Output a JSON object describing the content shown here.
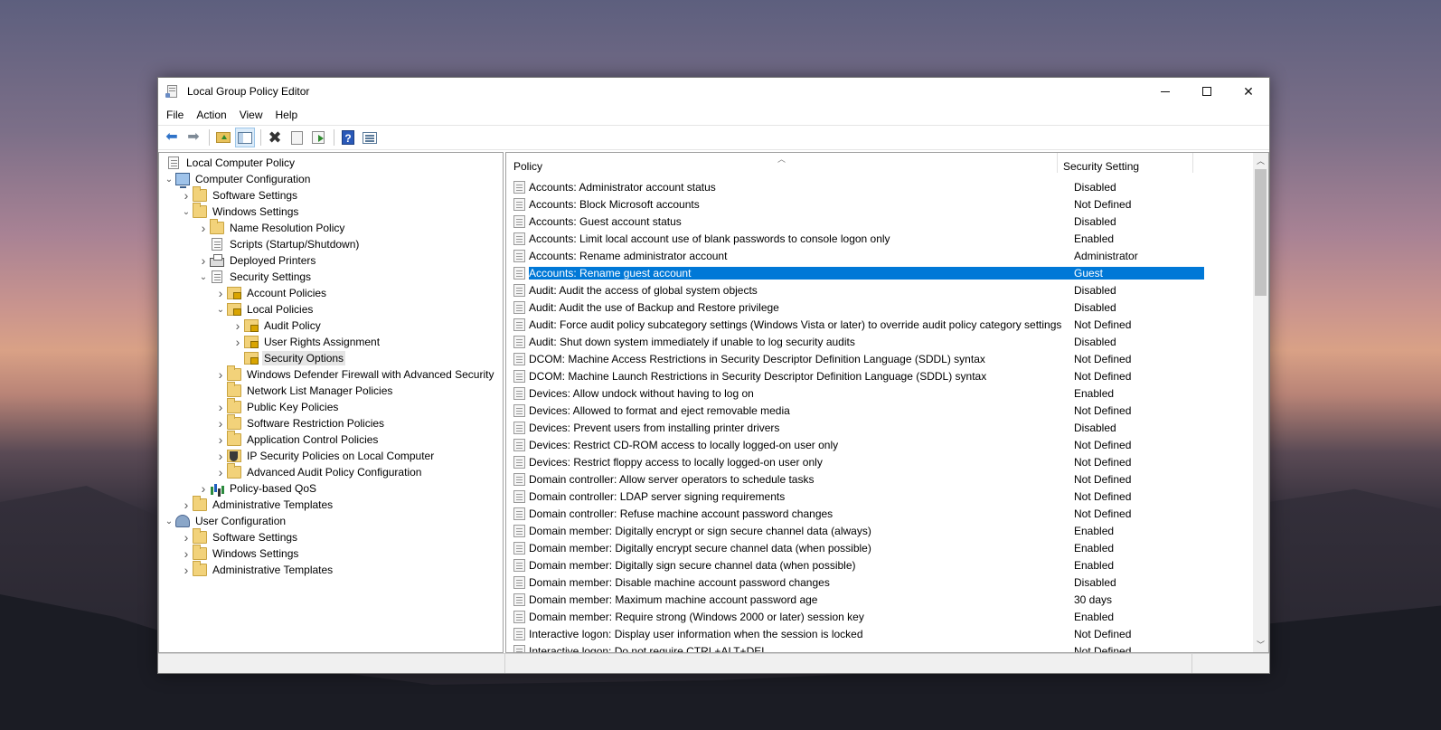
{
  "window": {
    "title": "Local Group Policy Editor"
  },
  "menu": [
    "File",
    "Action",
    "View",
    "Help"
  ],
  "toolbar": [
    {
      "name": "back-button",
      "icon": "back-arrow-icon"
    },
    {
      "name": "forward-button",
      "icon": "forward-arrow-icon"
    },
    {
      "name": "up-one-level-button",
      "icon": "folder-up-icon"
    },
    {
      "name": "show-hide-console-tree-button",
      "icon": "console-tree-icon"
    },
    {
      "name": "delete-button",
      "icon": "delete-x-icon"
    },
    {
      "name": "properties-button",
      "icon": "properties-icon"
    },
    {
      "name": "export-list-button",
      "icon": "export-list-icon"
    },
    {
      "name": "help-button",
      "icon": "help-icon",
      "glyph": "?"
    },
    {
      "name": "show-hide-action-pane-button",
      "icon": "action-pane-icon"
    }
  ],
  "tree": [
    {
      "label": "Local Computer Policy",
      "level": 0,
      "expander": "",
      "icon": "doc"
    },
    {
      "label": "Computer Configuration",
      "level": 0,
      "expander": "open",
      "icon": "computer"
    },
    {
      "label": "Software Settings",
      "level": 1,
      "expander": "closed",
      "icon": "folder"
    },
    {
      "label": "Windows Settings",
      "level": 1,
      "expander": "open",
      "icon": "folder"
    },
    {
      "label": "Name Resolution Policy",
      "level": 2,
      "expander": "closed",
      "icon": "folder"
    },
    {
      "label": "Scripts (Startup/Shutdown)",
      "level": 2,
      "expander": "",
      "icon": "doc"
    },
    {
      "label": "Deployed Printers",
      "level": 2,
      "expander": "closed",
      "icon": "printer"
    },
    {
      "label": "Security Settings",
      "level": 2,
      "expander": "open",
      "icon": "doc"
    },
    {
      "label": "Account Policies",
      "level": 3,
      "expander": "closed",
      "icon": "lock"
    },
    {
      "label": "Local Policies",
      "level": 3,
      "expander": "open",
      "icon": "lock"
    },
    {
      "label": "Audit Policy",
      "level": 4,
      "expander": "closed",
      "icon": "lock"
    },
    {
      "label": "User Rights Assignment",
      "level": 4,
      "expander": "closed",
      "icon": "lock"
    },
    {
      "label": "Security Options",
      "level": 4,
      "expander": "",
      "icon": "lock",
      "selected": true
    },
    {
      "label": "Windows Defender Firewall with Advanced Security",
      "level": 3,
      "expander": "closed",
      "icon": "folder"
    },
    {
      "label": "Network List Manager Policies",
      "level": 3,
      "expander": "",
      "icon": "folder"
    },
    {
      "label": "Public Key Policies",
      "level": 3,
      "expander": "closed",
      "icon": "folder"
    },
    {
      "label": "Software Restriction Policies",
      "level": 3,
      "expander": "closed",
      "icon": "folder"
    },
    {
      "label": "Application Control Policies",
      "level": 3,
      "expander": "closed",
      "icon": "folder"
    },
    {
      "label": "IP Security Policies on Local Computer",
      "level": 3,
      "expander": "closed",
      "icon": "shield"
    },
    {
      "label": "Advanced Audit Policy Configuration",
      "level": 3,
      "expander": "closed",
      "icon": "folder"
    },
    {
      "label": "Policy-based QoS",
      "level": 2,
      "expander": "closed",
      "icon": "chart"
    },
    {
      "label": "Administrative Templates",
      "level": 1,
      "expander": "closed",
      "icon": "folder"
    },
    {
      "label": "User Configuration",
      "level": 0,
      "expander": "open",
      "icon": "user"
    },
    {
      "label": "Software Settings",
      "level": 1,
      "expander": "closed",
      "icon": "folder"
    },
    {
      "label": "Windows Settings",
      "level": 1,
      "expander": "closed",
      "icon": "folder"
    },
    {
      "label": "Administrative Templates",
      "level": 1,
      "expander": "closed",
      "icon": "folder"
    }
  ],
  "list": {
    "columns": [
      "Policy",
      "Security Setting"
    ],
    "rows": [
      {
        "policy": "Accounts: Administrator account status",
        "setting": "Disabled"
      },
      {
        "policy": "Accounts: Block Microsoft accounts",
        "setting": "Not Defined"
      },
      {
        "policy": "Accounts: Guest account status",
        "setting": "Disabled"
      },
      {
        "policy": "Accounts: Limit local account use of blank passwords to console logon only",
        "setting": "Enabled"
      },
      {
        "policy": "Accounts: Rename administrator account",
        "setting": "Administrator"
      },
      {
        "policy": "Accounts: Rename guest account",
        "setting": "Guest",
        "selected": true
      },
      {
        "policy": "Audit: Audit the access of global system objects",
        "setting": "Disabled"
      },
      {
        "policy": "Audit: Audit the use of Backup and Restore privilege",
        "setting": "Disabled"
      },
      {
        "policy": "Audit: Force audit policy subcategory settings (Windows Vista or later) to override audit policy category settings",
        "setting": "Not Defined"
      },
      {
        "policy": "Audit: Shut down system immediately if unable to log security audits",
        "setting": "Disabled"
      },
      {
        "policy": "DCOM: Machine Access Restrictions in Security Descriptor Definition Language (SDDL) syntax",
        "setting": "Not Defined"
      },
      {
        "policy": "DCOM: Machine Launch Restrictions in Security Descriptor Definition Language (SDDL) syntax",
        "setting": "Not Defined"
      },
      {
        "policy": "Devices: Allow undock without having to log on",
        "setting": "Enabled"
      },
      {
        "policy": "Devices: Allowed to format and eject removable media",
        "setting": "Not Defined"
      },
      {
        "policy": "Devices: Prevent users from installing printer drivers",
        "setting": "Disabled"
      },
      {
        "policy": "Devices: Restrict CD-ROM access to locally logged-on user only",
        "setting": "Not Defined"
      },
      {
        "policy": "Devices: Restrict floppy access to locally logged-on user only",
        "setting": "Not Defined"
      },
      {
        "policy": "Domain controller: Allow server operators to schedule tasks",
        "setting": "Not Defined"
      },
      {
        "policy": "Domain controller: LDAP server signing requirements",
        "setting": "Not Defined"
      },
      {
        "policy": "Domain controller: Refuse machine account password changes",
        "setting": "Not Defined"
      },
      {
        "policy": "Domain member: Digitally encrypt or sign secure channel data (always)",
        "setting": "Enabled"
      },
      {
        "policy": "Domain member: Digitally encrypt secure channel data (when possible)",
        "setting": "Enabled"
      },
      {
        "policy": "Domain member: Digitally sign secure channel data (when possible)",
        "setting": "Enabled"
      },
      {
        "policy": "Domain member: Disable machine account password changes",
        "setting": "Disabled"
      },
      {
        "policy": "Domain member: Maximum machine account password age",
        "setting": "30 days"
      },
      {
        "policy": "Domain member: Require strong (Windows 2000 or later) session key",
        "setting": "Enabled"
      },
      {
        "policy": "Interactive logon: Display user information when the session is locked",
        "setting": "Not Defined"
      },
      {
        "policy": "Interactive logon: Do not require CTRL+ALT+DEL",
        "setting": "Not Defined"
      }
    ]
  },
  "colors": {
    "selection": "#0078d7",
    "accent": "#2e72c8"
  }
}
